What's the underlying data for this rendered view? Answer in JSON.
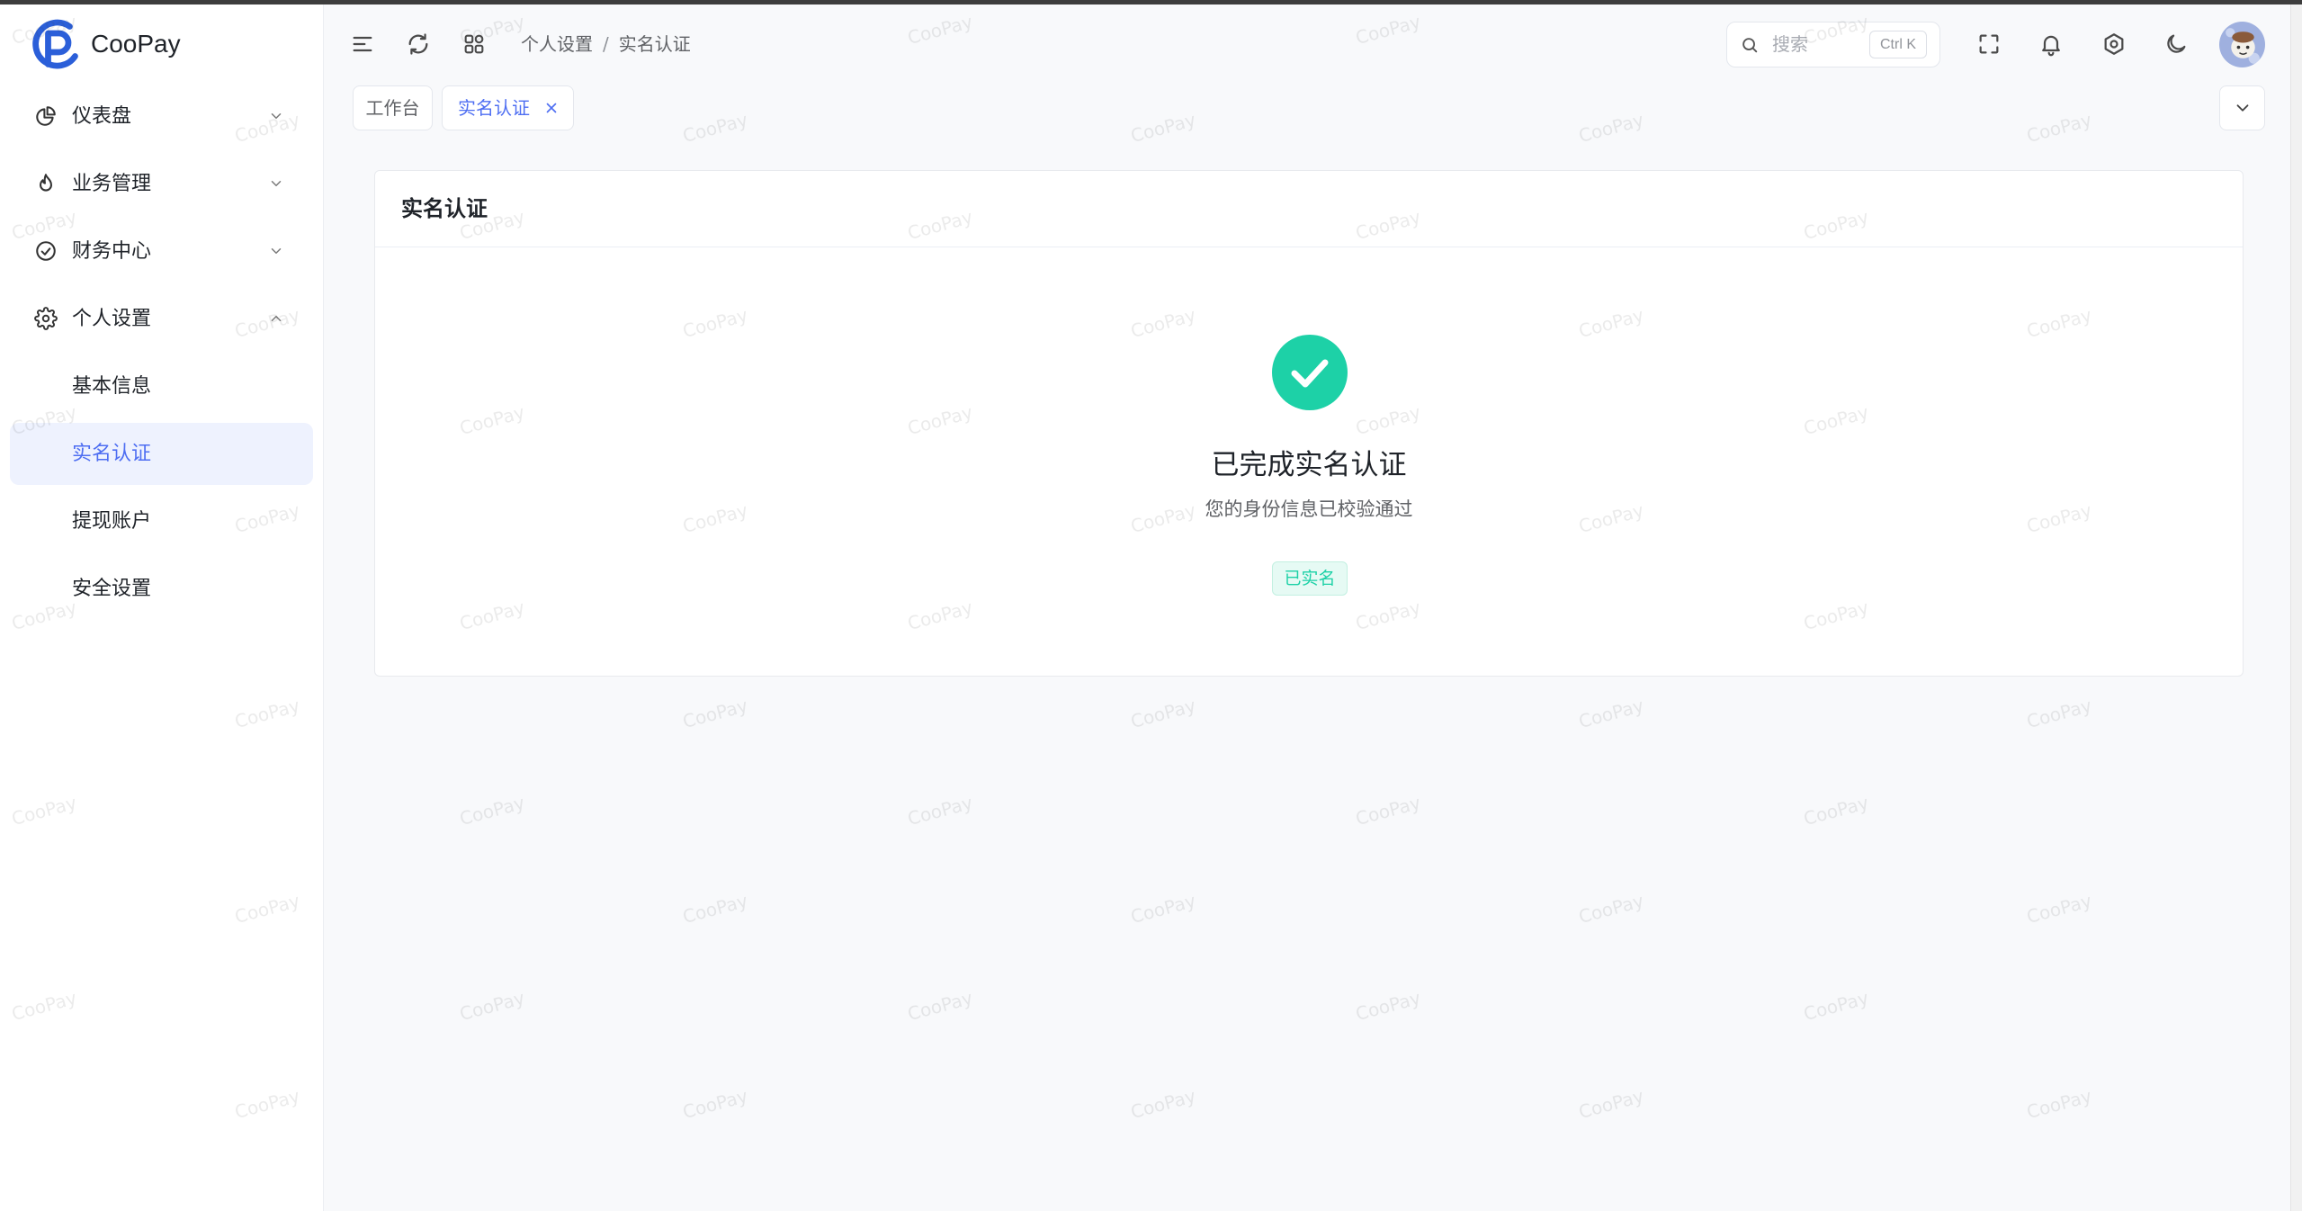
{
  "watermark": "CooPay",
  "brand": {
    "name": "CooPay",
    "logo_icon": "coopay-logo-icon"
  },
  "colors": {
    "primary": "#4e6ef2",
    "success": "#1dd1a7",
    "badge_bg": "#e6faf4",
    "logo": "#2b5fd9"
  },
  "sidebar": {
    "items": [
      {
        "label": "仪表盘",
        "icon": "pie-chart-icon",
        "expanded": false
      },
      {
        "label": "业务管理",
        "icon": "flame-icon",
        "expanded": false
      },
      {
        "label": "财务中心",
        "icon": "check-circle-icon",
        "expanded": false
      },
      {
        "label": "个人设置",
        "icon": "gear-icon",
        "expanded": true,
        "children": [
          {
            "label": "基本信息",
            "active": false
          },
          {
            "label": "实名认证",
            "active": true
          },
          {
            "label": "提现账户",
            "active": false
          },
          {
            "label": "安全设置",
            "active": false
          }
        ]
      }
    ]
  },
  "header": {
    "breadcrumb": [
      "个人设置",
      "实名认证"
    ],
    "breadcrumb_separator": "/",
    "search": {
      "placeholder": "搜索",
      "shortcut": "Ctrl K"
    },
    "icons": [
      "menu-fold-icon",
      "refresh-icon",
      "apps-grid-icon",
      "fullscreen-icon",
      "bell-icon",
      "settings-icon",
      "moon-icon"
    ]
  },
  "tabs": [
    {
      "label": "工作台",
      "active": false
    },
    {
      "label": "实名认证",
      "active": true,
      "closable": true
    }
  ],
  "card": {
    "title": "实名认证",
    "result_title": "已完成实名认证",
    "result_subtitle": "您的身份信息已校验通过",
    "status_badge": "已实名"
  }
}
